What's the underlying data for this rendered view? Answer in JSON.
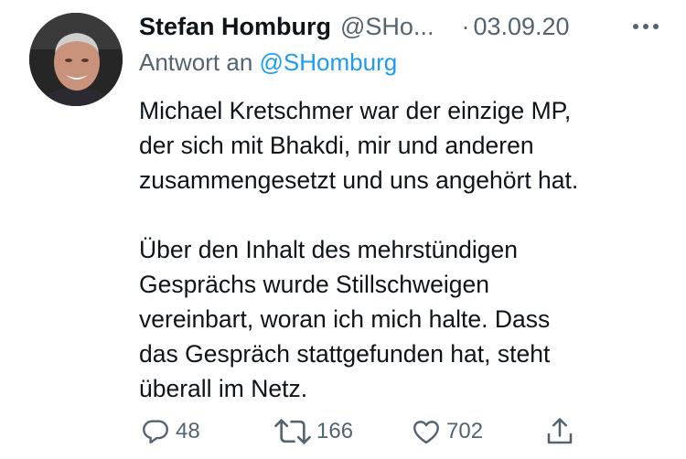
{
  "author": {
    "name": "Stefan Homburg",
    "handle": "@SHo...",
    "separator": "·",
    "date": "03.09.20"
  },
  "reply_to": {
    "prefix": "Antwort an",
    "mention": "@SHomburg"
  },
  "tweet": {
    "paragraph_1": "Michael Kretschmer war der einzige MP,\nder sich mit Bhakdi, mir und anderen\nzusammengesetzt und uns angehört hat.",
    "paragraph_2": "Über den Inhalt des mehrstündigen\nGesprächs wurde Stillschweigen\nvereinbart, woran ich mich halte. Dass\ndas Gespräch stattgefunden hat, steht\nüberall im Netz."
  },
  "actions": {
    "replies": "48",
    "retweets": "166",
    "likes": "702"
  },
  "icons": {
    "reply": "speech-bubble-icon",
    "retweet": "retweet-arrows-icon",
    "like": "heart-outline-icon",
    "share": "share-upload-icon",
    "more": "more-horizontal-icon"
  },
  "colors": {
    "text": "#0f1419",
    "secondary": "#536471",
    "link": "#1d9bf0",
    "background": "#ffffff"
  }
}
